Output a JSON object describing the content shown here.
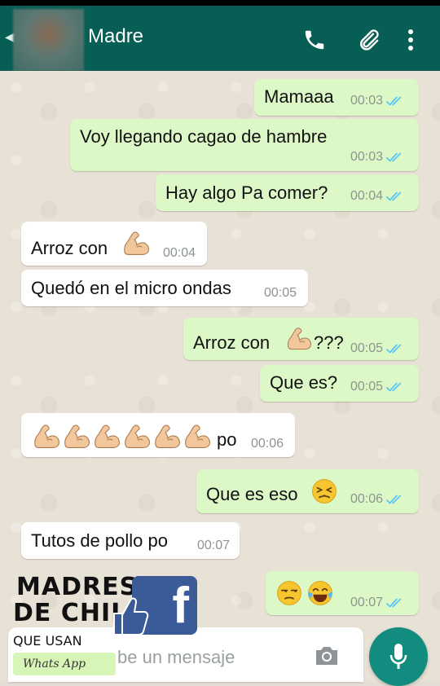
{
  "header": {
    "contact_name": "Madre",
    "icons": [
      "back-arrow-icon",
      "phone-icon",
      "attach-icon",
      "more-vert-icon"
    ]
  },
  "messages": [
    {
      "dir": "out",
      "text": "Mamaaa",
      "time": "00:03",
      "status": "read"
    },
    {
      "dir": "out",
      "text": "Voy llegando cagao de hambre",
      "time": "00:03",
      "status": "read"
    },
    {
      "dir": "out",
      "text": "Hay algo Pa comer?",
      "time": "00:04",
      "status": "read"
    },
    {
      "dir": "in",
      "text": "Arroz con",
      "emoji": "flexed-biceps",
      "time": "00:04"
    },
    {
      "dir": "in",
      "text": "Quedó en el micro ondas",
      "time": "00:05"
    },
    {
      "dir": "out",
      "text": "Arroz con",
      "emoji": "flexed-biceps",
      "suffix": "???",
      "time": "00:05",
      "status": "read"
    },
    {
      "dir": "out",
      "text": "Que es?",
      "time": "00:05",
      "status": "read"
    },
    {
      "dir": "in",
      "emoji_count": 6,
      "emoji": "flexed-biceps",
      "text": "po",
      "time": "00:06"
    },
    {
      "dir": "out",
      "text": "Que es eso",
      "emoji": "persevering-face",
      "time": "00:06",
      "status": "read"
    },
    {
      "dir": "in",
      "text": "Tutos de pollo po",
      "time": "00:07"
    },
    {
      "dir": "out",
      "emojis": [
        "unamused-face",
        "face-with-tears-of-joy"
      ],
      "time": "00:07",
      "status": "read"
    }
  ],
  "input": {
    "placeholder": "Escribe un mensaje",
    "visible_placeholder": "be un mensaje"
  },
  "watermark": {
    "line1": "MADRES",
    "line2": "DE CHILE",
    "line3": "QUE USAN",
    "badge": "Whats App",
    "fb_letter": "f"
  },
  "colors": {
    "header": "#075e54",
    "outgoing_bubble": "#dcf8c6",
    "incoming_bubble": "#ffffff",
    "tick_read": "#4fc3f7",
    "mic_button": "#128c7e"
  }
}
